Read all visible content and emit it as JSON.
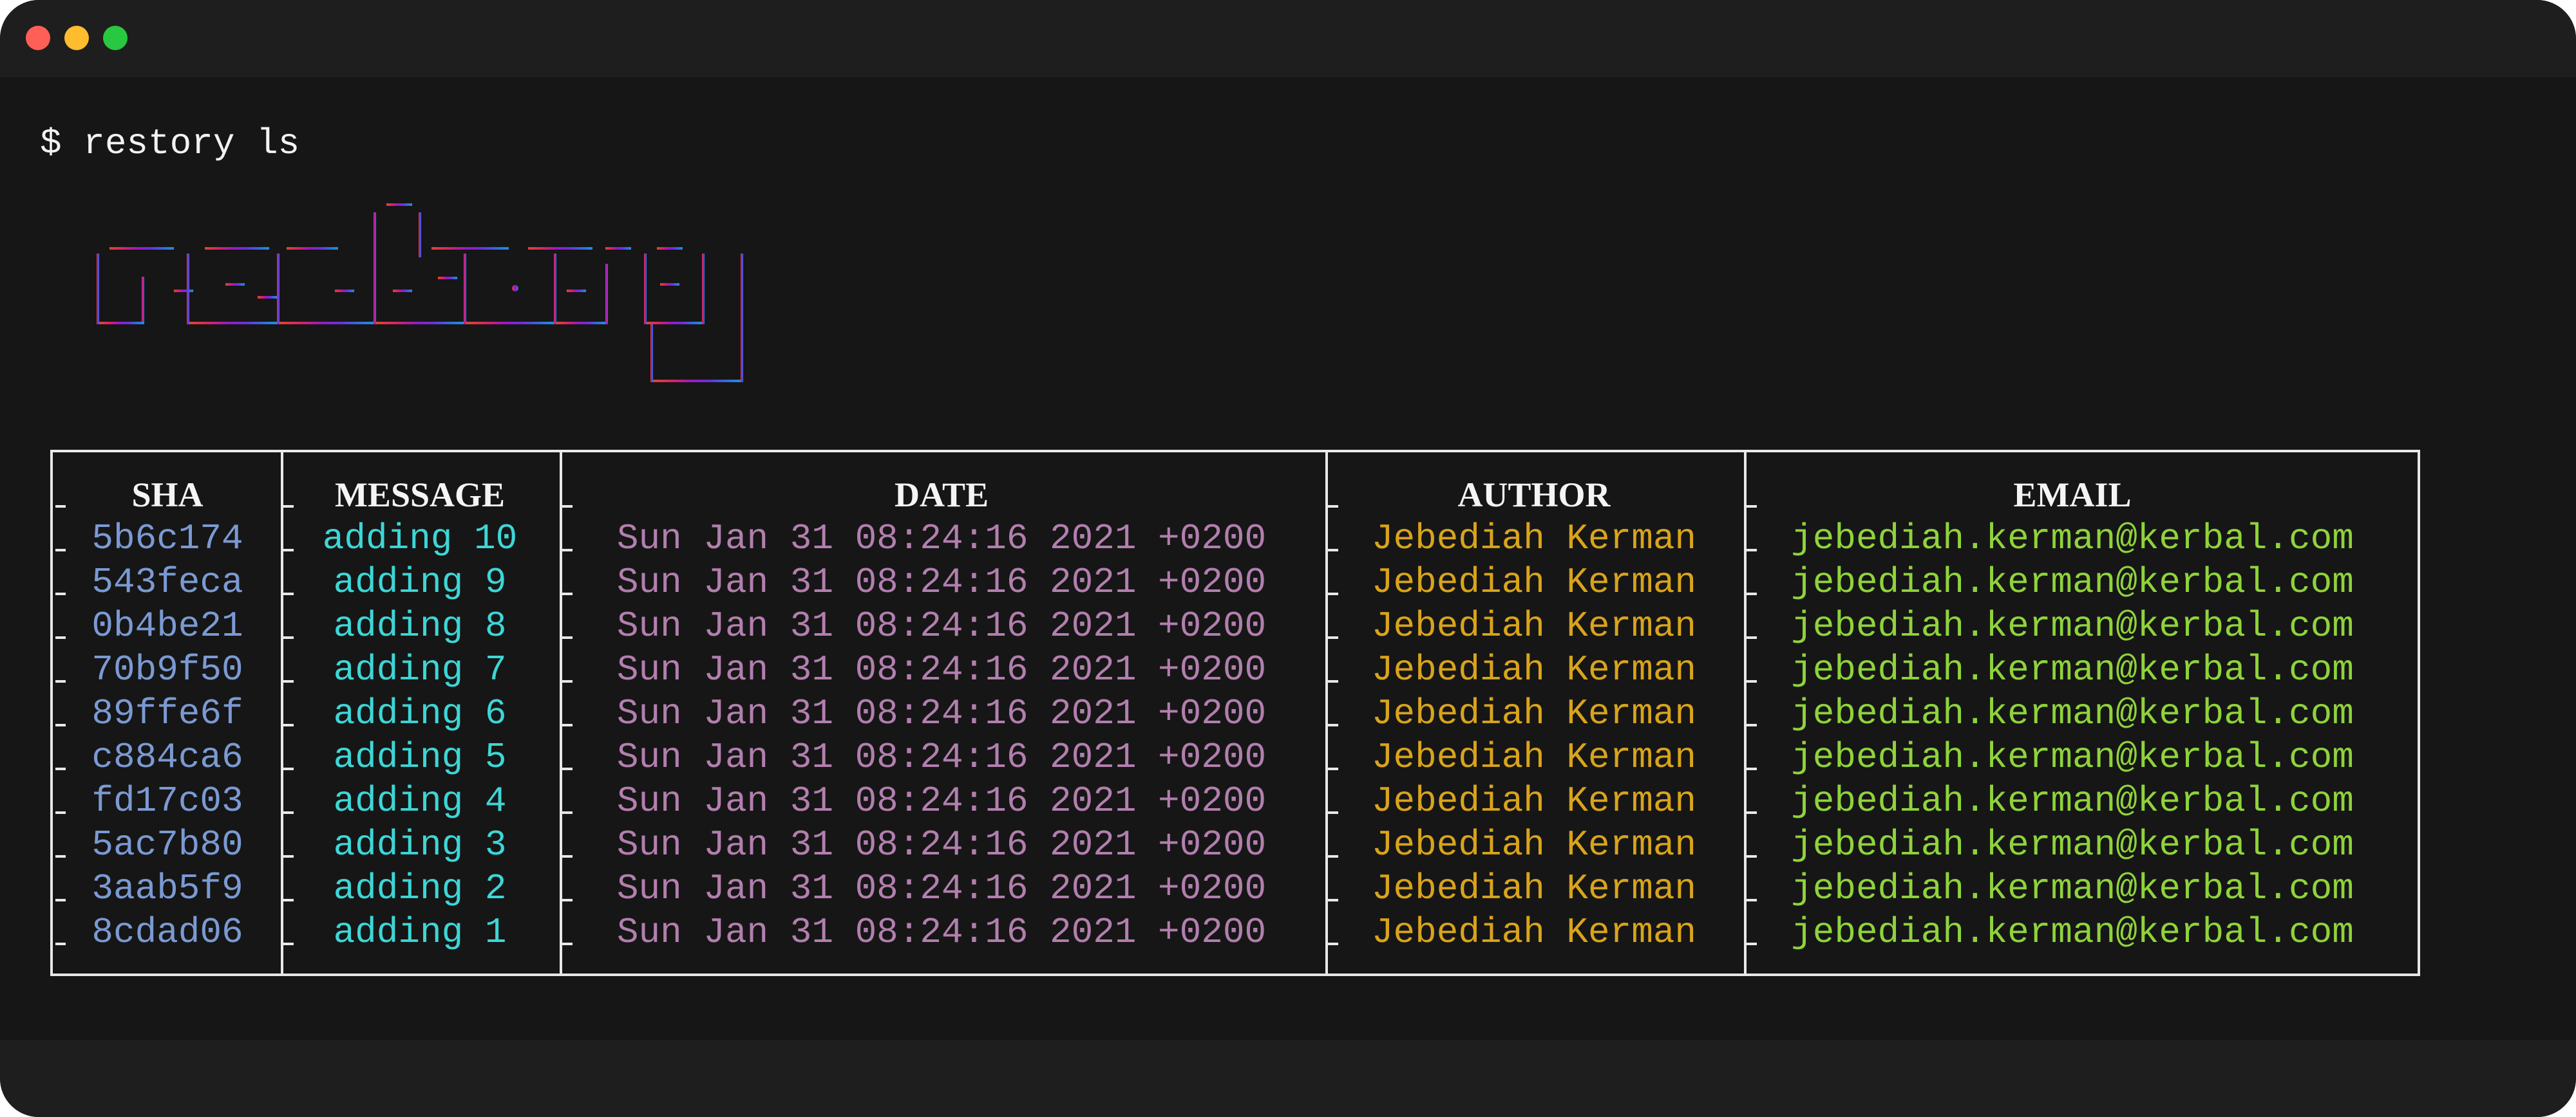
{
  "terminal": {
    "prompt_symbol": "$",
    "command": "restory ls",
    "banner_text": "restory"
  },
  "table": {
    "headers": [
      "SHA",
      "MESSAGE",
      "DATE",
      "AUTHOR",
      "EMAIL"
    ],
    "rows": [
      [
        "5b6c174",
        "adding 10",
        "Sun Jan 31 08:24:16 2021 +0200",
        "Jebediah Kerman",
        "jebediah.kerman@kerbal.com"
      ],
      [
        "543feca",
        "adding 9",
        "Sun Jan 31 08:24:16 2021 +0200",
        "Jebediah Kerman",
        "jebediah.kerman@kerbal.com"
      ],
      [
        "0b4be21",
        "adding 8",
        "Sun Jan 31 08:24:16 2021 +0200",
        "Jebediah Kerman",
        "jebediah.kerman@kerbal.com"
      ],
      [
        "70b9f50",
        "adding 7",
        "Sun Jan 31 08:24:16 2021 +0200",
        "Jebediah Kerman",
        "jebediah.kerman@kerbal.com"
      ],
      [
        "89ffe6f",
        "adding 6",
        "Sun Jan 31 08:24:16 2021 +0200",
        "Jebediah Kerman",
        "jebediah.kerman@kerbal.com"
      ],
      [
        "c884ca6",
        "adding 5",
        "Sun Jan 31 08:24:16 2021 +0200",
        "Jebediah Kerman",
        "jebediah.kerman@kerbal.com"
      ],
      [
        "fd17c03",
        "adding 4",
        "Sun Jan 31 08:24:16 2021 +0200",
        "Jebediah Kerman",
        "jebediah.kerman@kerbal.com"
      ],
      [
        "5ac7b80",
        "adding 3",
        "Sun Jan 31 08:24:16 2021 +0200",
        "Jebediah Kerman",
        "jebediah.kerman@kerbal.com"
      ],
      [
        "3aab5f9",
        "adding 2",
        "Sun Jan 31 08:24:16 2021 +0200",
        "Jebediah Kerman",
        "jebediah.kerman@kerbal.com"
      ],
      [
        "8cdad06",
        "adding 1",
        "Sun Jan 31 08:24:16 2021 +0200",
        "Jebediah Kerman",
        "jebediah.kerman@kerbal.com"
      ]
    ]
  },
  "colors": {
    "sha": "#7b9ad3",
    "message": "#3ed6d6",
    "date": "#b27fae",
    "author": "#d9a41c",
    "email": "#8fd33b",
    "banner_gradient": [
      "#e0452e",
      "#d81f6e",
      "#9b18c8",
      "#6b30e0",
      "#2f6ee0",
      "#1e8fe0"
    ]
  }
}
